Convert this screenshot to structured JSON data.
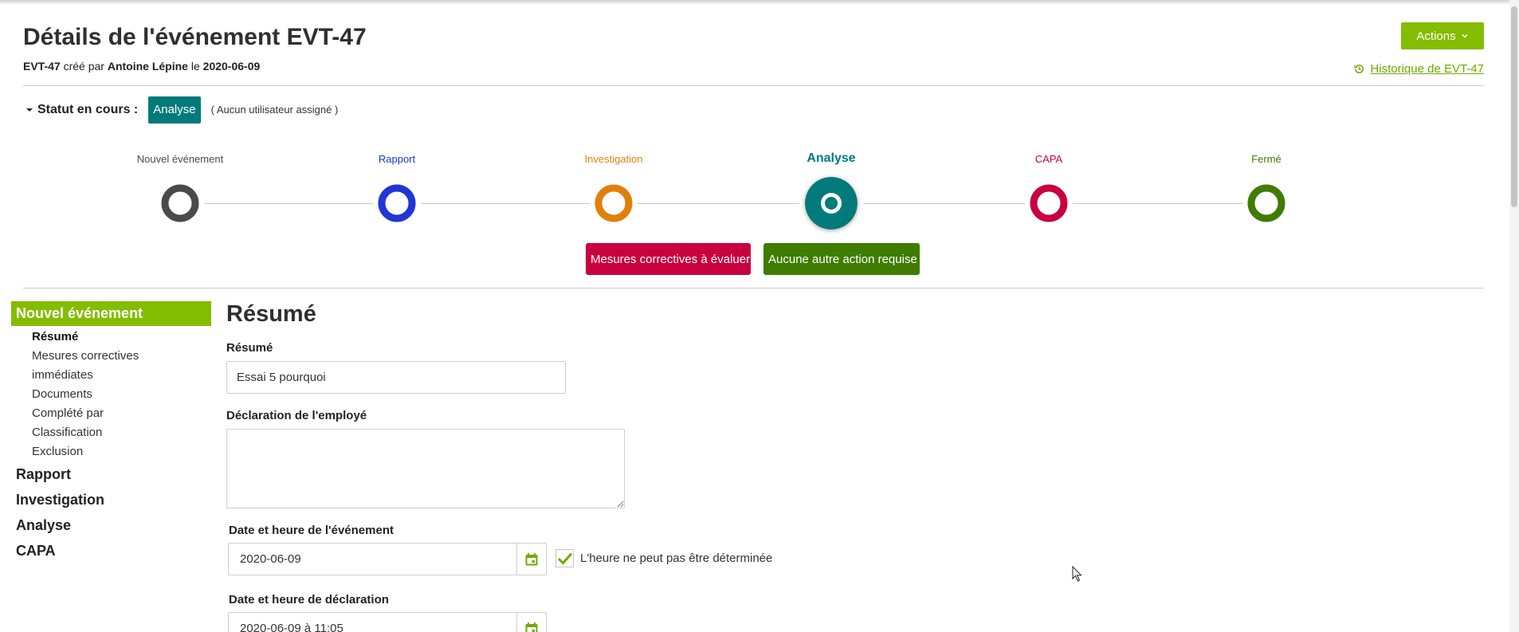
{
  "header": {
    "title": "Détails de l'événement EVT-47",
    "meta": {
      "event_id": "EVT-47",
      "created_by_text": "créé par",
      "author": "Antoine Lépine",
      "on_text": "le",
      "date": "2020-06-09"
    },
    "actions_label": "Actions",
    "history_label": "Historique de EVT-47"
  },
  "status": {
    "label": "Statut en cours :",
    "badge": "Analyse",
    "note": "( Aucun utilisateur assigné )"
  },
  "stepper": {
    "steps": [
      {
        "label": "Nouvel événement",
        "color": "#4a4a4a",
        "active": false
      },
      {
        "label": "Rapport",
        "color": "#1f35d6",
        "active": false
      },
      {
        "label": "Investigation",
        "color": "#e0800a",
        "active": false
      },
      {
        "label": "Analyse",
        "color": "#007a7a",
        "active": true
      },
      {
        "label": "CAPA",
        "color": "#c8003f",
        "active": false
      },
      {
        "label": "Fermé",
        "color": "#3f7c00",
        "active": false
      }
    ],
    "branches": [
      {
        "label": "Mesures correctives à évaluer",
        "color": "#c8003f"
      },
      {
        "label": "Aucune autre action requise",
        "color": "#3f7c00"
      }
    ]
  },
  "sidebar": {
    "active_section": "Nouvel événement",
    "sub_items": [
      "Résumé",
      "Mesures correctives",
      "immédiates",
      "Documents",
      "Complété par",
      "Classification",
      "Exclusion"
    ],
    "sections": [
      "Rapport",
      "Investigation",
      "Analyse",
      "CAPA"
    ]
  },
  "form": {
    "section_title": "Résumé",
    "summary": {
      "label": "Résumé",
      "value": "Essai 5 pourquoi"
    },
    "employee_statement": {
      "label": "Déclaration de l'employé",
      "value": ""
    },
    "event_datetime": {
      "label": "Date et heure de l'événement",
      "value": "2020-06-09"
    },
    "time_undetermined": {
      "label": "L'heure ne peut pas être déterminée",
      "checked": true
    },
    "declaration_datetime": {
      "label": "Date et heure de déclaration",
      "value": "2020-06-09 à 11:05"
    }
  },
  "colors": {
    "accent_green": "#84bc00",
    "teal": "#007a7a",
    "link_green": "#72a900"
  }
}
